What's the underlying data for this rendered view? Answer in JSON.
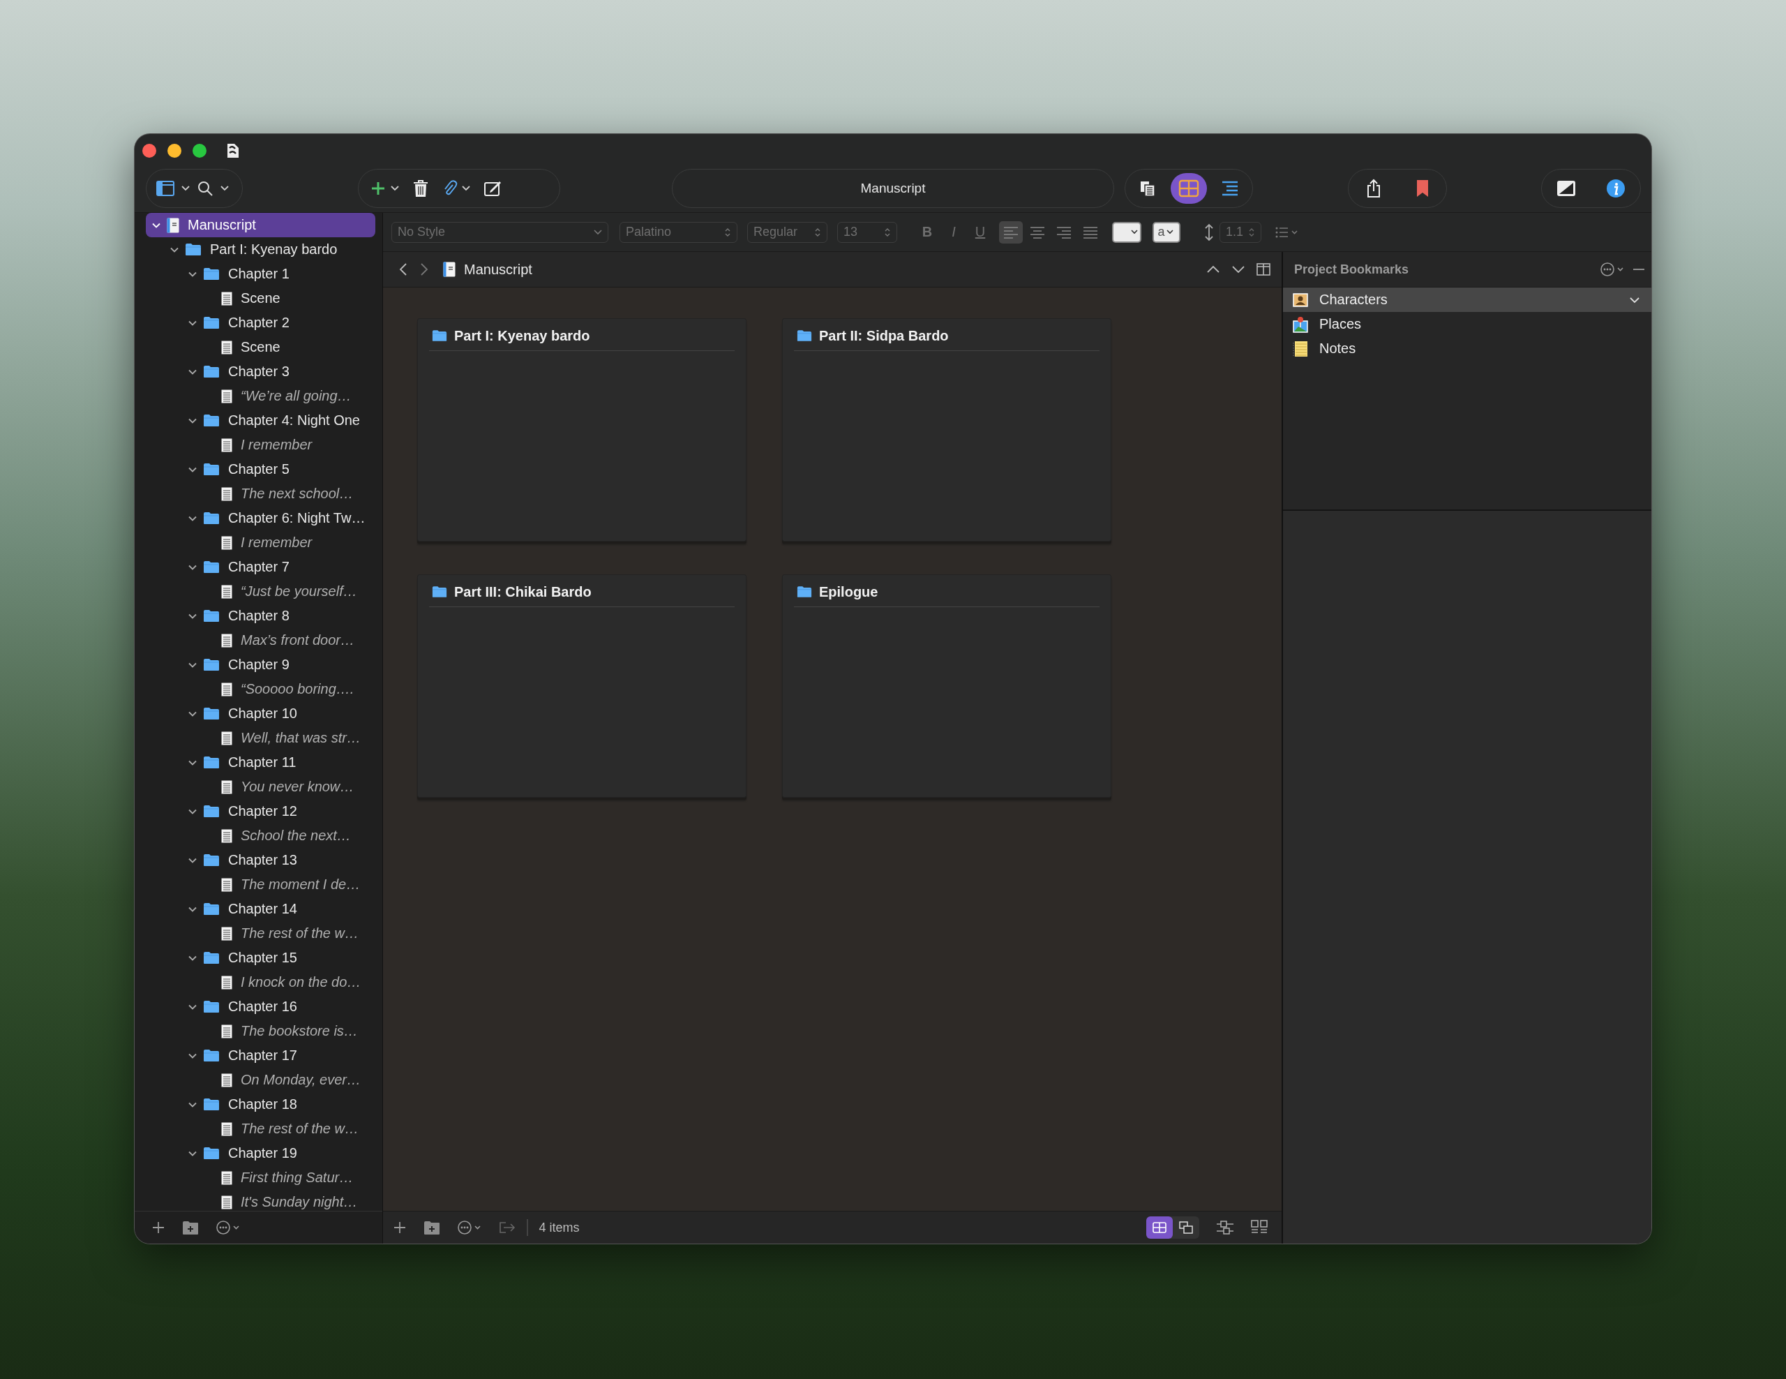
{
  "toolbar": {
    "title": "Manuscript",
    "view_modes": [
      {
        "kind": "scrivenings",
        "selected": false
      },
      {
        "kind": "corkboard",
        "selected": true
      },
      {
        "kind": "outliner",
        "selected": false
      }
    ]
  },
  "format_bar": {
    "style": "No Style",
    "font": "Palatino",
    "weight": "Regular",
    "size": "13",
    "bold": "B",
    "italic": "I",
    "underline": "U",
    "alignment": [
      {
        "kind": "left",
        "selected": true
      },
      {
        "kind": "center",
        "selected": false
      },
      {
        "kind": "right",
        "selected": false
      },
      {
        "kind": "justify",
        "selected": false
      }
    ],
    "highlight": "a",
    "line_spacing": "1.1"
  },
  "binder": {
    "items": [
      {
        "title": "Manuscript",
        "kind": "manuscript",
        "selected": true,
        "expanded": true,
        "children": [
          {
            "title": "Part I: Kyenay bardo",
            "kind": "folder",
            "selected": false,
            "expanded": true,
            "children": [
              {
                "title": "Chapter 1",
                "kind": "folder",
                "selected": false,
                "expanded": true,
                "children": [
                  {
                    "title": "Scene",
                    "kind": "document",
                    "preview": false,
                    "selected": false
                  }
                ]
              },
              {
                "title": "Chapter 2",
                "kind": "folder",
                "selected": false,
                "expanded": true,
                "children": [
                  {
                    "title": "Scene",
                    "kind": "document",
                    "preview": false,
                    "selected": false
                  }
                ]
              },
              {
                "title": "Chapter 3",
                "kind": "folder",
                "selected": false,
                "expanded": true,
                "children": [
                  {
                    "title": "“We’re all going…",
                    "kind": "document",
                    "preview": true,
                    "selected": false
                  }
                ]
              },
              {
                "title": "Chapter 4: Night One",
                "kind": "folder",
                "selected": false,
                "expanded": true,
                "children": [
                  {
                    "title": "I remember",
                    "kind": "document",
                    "preview": true,
                    "selected": false
                  }
                ]
              },
              {
                "title": "Chapter 5",
                "kind": "folder",
                "selected": false,
                "expanded": true,
                "children": [
                  {
                    "title": "The next school…",
                    "kind": "document",
                    "preview": true,
                    "selected": false
                  }
                ]
              },
              {
                "title": "Chapter 6: Night Tw…",
                "kind": "folder",
                "selected": false,
                "expanded": true,
                "children": [
                  {
                    "title": "I remember",
                    "kind": "document",
                    "preview": true,
                    "selected": false
                  }
                ]
              },
              {
                "title": "Chapter 7",
                "kind": "folder",
                "selected": false,
                "expanded": true,
                "children": [
                  {
                    "title": "“Just be yourself…",
                    "kind": "document",
                    "preview": true,
                    "selected": false
                  }
                ]
              },
              {
                "title": "Chapter 8",
                "kind": "folder",
                "selected": false,
                "expanded": true,
                "children": [
                  {
                    "title": "Max’s front door…",
                    "kind": "document",
                    "preview": true,
                    "selected": false
                  }
                ]
              },
              {
                "title": "Chapter 9",
                "kind": "folder",
                "selected": false,
                "expanded": true,
                "children": [
                  {
                    "title": "“Sooooo boring….",
                    "kind": "document",
                    "preview": true,
                    "selected": false
                  }
                ]
              },
              {
                "title": "Chapter 10",
                "kind": "folder",
                "selected": false,
                "expanded": true,
                "children": [
                  {
                    "title": "Well, that was str…",
                    "kind": "document",
                    "preview": true,
                    "selected": false
                  }
                ]
              },
              {
                "title": "Chapter 11",
                "kind": "folder",
                "selected": false,
                "expanded": true,
                "children": [
                  {
                    "title": "You never know…",
                    "kind": "document",
                    "preview": true,
                    "selected": false
                  }
                ]
              },
              {
                "title": "Chapter 12",
                "kind": "folder",
                "selected": false,
                "expanded": true,
                "children": [
                  {
                    "title": "School the next…",
                    "kind": "document",
                    "preview": true,
                    "selected": false
                  }
                ]
              },
              {
                "title": "Chapter 13",
                "kind": "folder",
                "selected": false,
                "expanded": true,
                "children": [
                  {
                    "title": "The moment I de…",
                    "kind": "document",
                    "preview": true,
                    "selected": false
                  }
                ]
              },
              {
                "title": "Chapter 14",
                "kind": "folder",
                "selected": false,
                "expanded": true,
                "children": [
                  {
                    "title": "The rest of the w…",
                    "kind": "document",
                    "preview": true,
                    "selected": false
                  }
                ]
              },
              {
                "title": "Chapter 15",
                "kind": "folder",
                "selected": false,
                "expanded": true,
                "children": [
                  {
                    "title": "I knock on the do…",
                    "kind": "document",
                    "preview": true,
                    "selected": false
                  }
                ]
              },
              {
                "title": "Chapter 16",
                "kind": "folder",
                "selected": false,
                "expanded": true,
                "children": [
                  {
                    "title": "The bookstore is…",
                    "kind": "document",
                    "preview": true,
                    "selected": false
                  }
                ]
              },
              {
                "title": "Chapter 17",
                "kind": "folder",
                "selected": false,
                "expanded": true,
                "children": [
                  {
                    "title": "On Monday, ever…",
                    "kind": "document",
                    "preview": true,
                    "selected": false
                  }
                ]
              },
              {
                "title": "Chapter 18",
                "kind": "folder",
                "selected": false,
                "expanded": true,
                "children": [
                  {
                    "title": "The rest of the w…",
                    "kind": "document",
                    "preview": true,
                    "selected": false
                  }
                ]
              },
              {
                "title": "Chapter 19",
                "kind": "folder",
                "selected": false,
                "expanded": true,
                "children": [
                  {
                    "title": "First thing Satur…",
                    "kind": "document",
                    "preview": true,
                    "selected": false
                  },
                  {
                    "title": "It's Sunday night…",
                    "kind": "document",
                    "preview": true,
                    "selected": false
                  }
                ]
              }
            ]
          }
        ]
      }
    ]
  },
  "editor": {
    "title": "Manuscript",
    "cards": [
      {
        "title": "Part I: Kyenay bardo"
      },
      {
        "title": "Part II: Sidpa Bardo"
      },
      {
        "title": "Part III: Chikai Bardo"
      },
      {
        "title": "Epilogue"
      }
    ],
    "item_count": "4 items",
    "board_modes": [
      {
        "kind": "grid",
        "selected": true
      },
      {
        "kind": "freeform",
        "selected": false
      }
    ]
  },
  "bookmarks": {
    "title": "Project Bookmarks",
    "items": [
      {
        "label": "Characters",
        "kind": "characters",
        "selected": true
      },
      {
        "label": "Places",
        "kind": "places",
        "selected": false
      },
      {
        "label": "Notes",
        "kind": "notes",
        "selected": false
      }
    ]
  }
}
